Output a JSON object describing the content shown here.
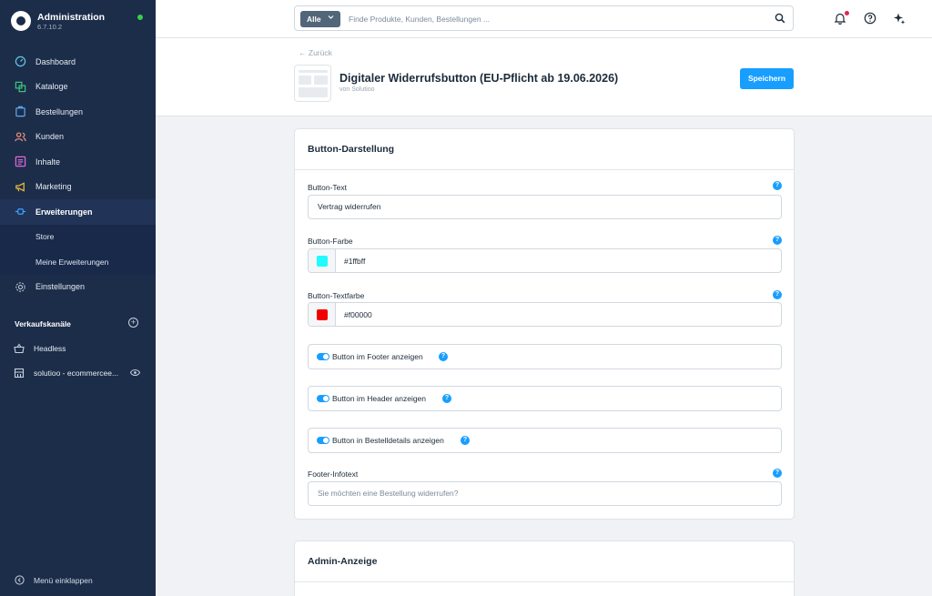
{
  "sidebar": {
    "brand_title": "Administration",
    "version": "6.7.10.2",
    "status_color": "#37d046",
    "items": [
      {
        "label": "Dashboard",
        "icon": "gauge-icon"
      },
      {
        "label": "Kataloge",
        "icon": "catalog-icon"
      },
      {
        "label": "Bestellungen",
        "icon": "shopping-bag-icon"
      },
      {
        "label": "Kunden",
        "icon": "users-icon"
      },
      {
        "label": "Inhalte",
        "icon": "content-icon"
      },
      {
        "label": "Marketing",
        "icon": "megaphone-icon"
      },
      {
        "label": "Erweiterungen",
        "icon": "plug-icon"
      },
      {
        "label": "Einstellungen",
        "icon": "gear-icon"
      }
    ],
    "sub_items": [
      "Store",
      "Meine Erweiterungen"
    ],
    "channels_heading": "Verkaufskanäle",
    "channels": [
      {
        "label": "Headless",
        "icon": "basket-icon"
      },
      {
        "label": "solutioo - ecommercee...",
        "icon": "storefront-icon"
      }
    ],
    "collapse_label": "Menü einklappen"
  },
  "topbar": {
    "search_type": "Alle",
    "search_placeholder": "Finde Produkte, Kunden, Bestellungen ..."
  },
  "page": {
    "back_label": "Zurück",
    "title": "Digitaler Widerrufsbutton (EU-Pflicht ab 19.06.2026)",
    "vendor": "von Solutioo",
    "save_label": "Speichern"
  },
  "card_display": {
    "title": "Button-Darstellung",
    "button_text_label": "Button-Text",
    "button_text_value": "Vertrag widerrufen",
    "button_color_label": "Button-Farbe",
    "button_color_value": "#1ffbff",
    "button_textcolor_label": "Button-Textfarbe",
    "button_textcolor_value": "#f00000",
    "toggle_footer": "Button im Footer anzeigen",
    "toggle_header": "Button im Header anzeigen",
    "toggle_orderdetails": "Button in Bestelldetails anzeigen",
    "footer_infotext_label": "Footer-Infotext",
    "footer_infotext_placeholder": "Sie möchten eine Bestellung widerrufen?"
  },
  "card_admin": {
    "title": "Admin-Anzeige"
  },
  "colors": {
    "accent": "#189eff",
    "sidebar_bg": "#1c2d4a",
    "notification_dot": "#de294c"
  }
}
